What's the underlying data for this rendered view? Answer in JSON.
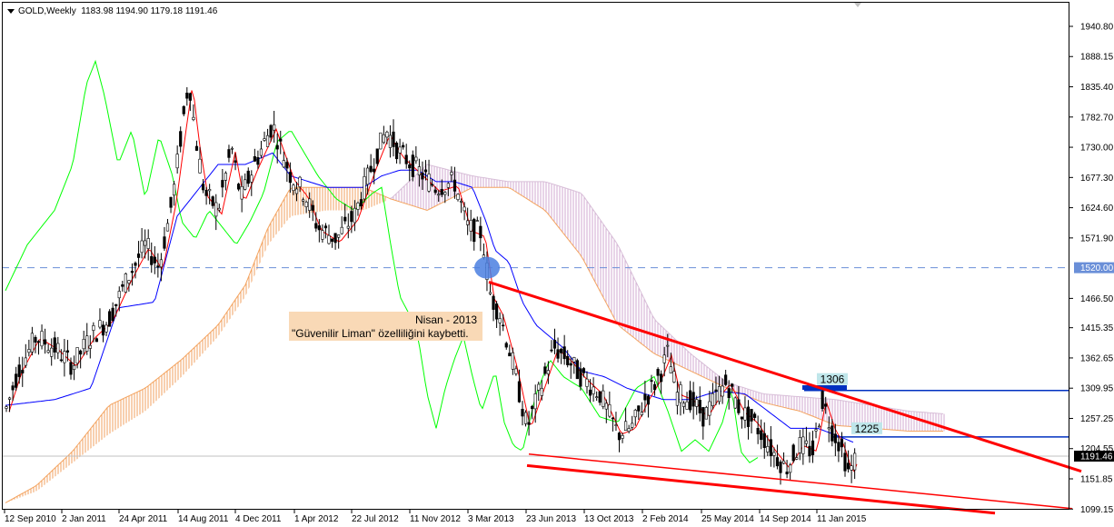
{
  "header": {
    "symbol_timeframe": "GOLD,Weekly",
    "ohlc": "1183.98 1194.90 1179.18 1191.46"
  },
  "annotations": {
    "line1": "Nisan - 2013",
    "line2": "\"Güvenilir Liman\" özelliliğini kaybetti.",
    "label_1306": "1306",
    "label_1225": "1225"
  },
  "price_axis": {
    "ticks": [
      "1940.80",
      "1888.15",
      "1835.40",
      "1782.70",
      "1730.00",
      "1677.30",
      "1624.60",
      "1571.90",
      "1466.50",
      "1415.35",
      "1362.65",
      "1309.95",
      "1257.25",
      "1204.55",
      "1151.85",
      "1099.15"
    ],
    "marker_1520": "1520.00",
    "current_price": "1191.46"
  },
  "time_axis": {
    "ticks": [
      "12 Sep 2010",
      "2 Jan 2011",
      "24 Apr 2011",
      "14 Aug 2011",
      "4 Dec 2011",
      "1 Apr 2012",
      "22 Jul 2012",
      "11 Nov 2012",
      "3 Mar 2013",
      "23 Jun 2013",
      "13 Oct 2013",
      "2 Feb 2014",
      "25 May 2014",
      "14 Sep 2014",
      "11 Jan 2015"
    ]
  },
  "colors": {
    "tenkan": "#ff0000",
    "kijun": "#0000ff",
    "chikou": "#00ff00",
    "kumo_bull": "#f4a460",
    "kumo_bear": "#d8bfd8",
    "trendline": "#ff0000",
    "hline_1520": "#6a8fd8",
    "level_lines": "#0030c0"
  }
}
